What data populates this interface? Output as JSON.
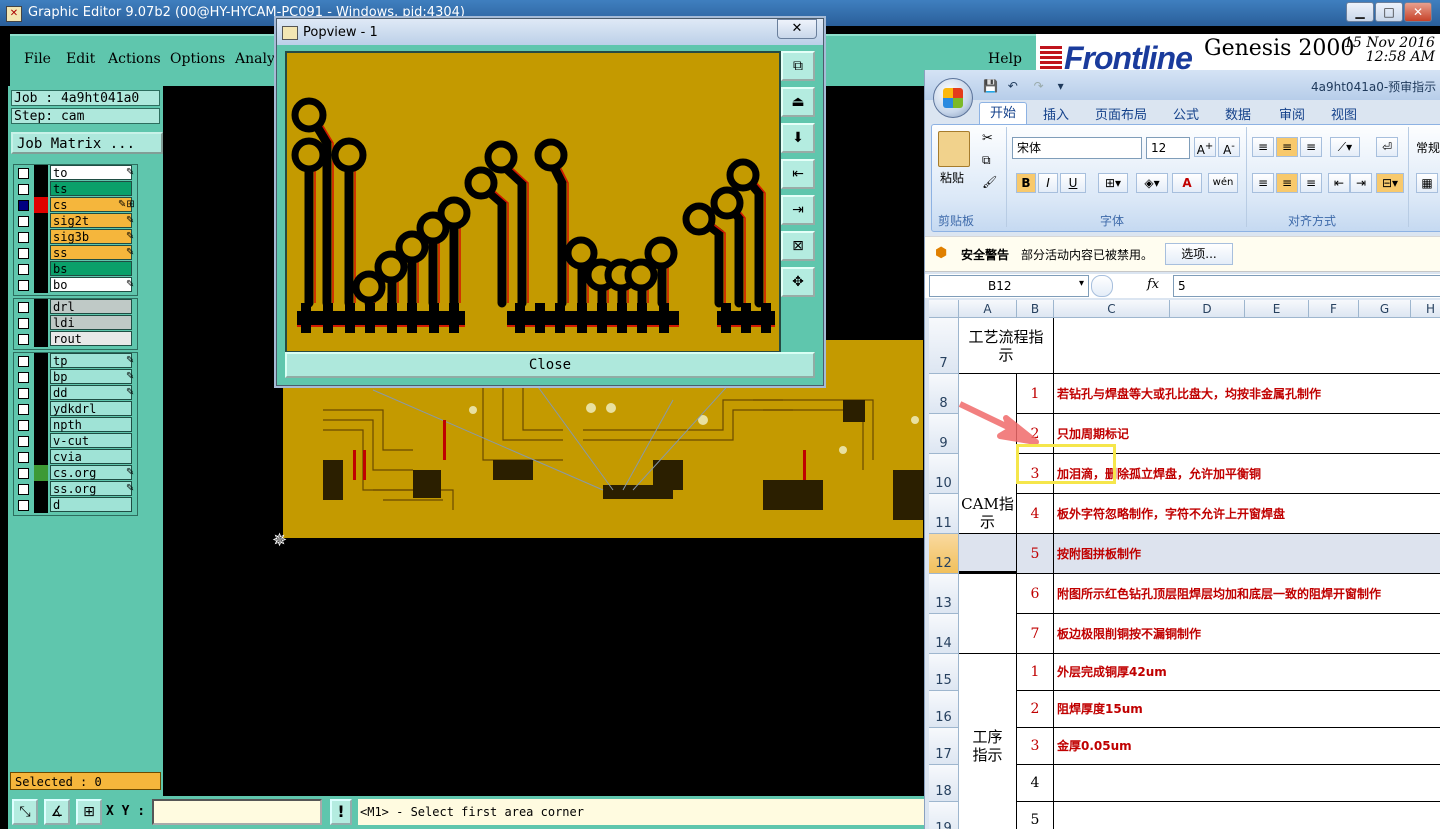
{
  "ge": {
    "title": "Graphic Editor 9.07b2 (00@HY-HYCAM-PC091 - Windows, pid:4304)",
    "menus": [
      "File",
      "Edit",
      "Actions",
      "Options",
      "Analys"
    ],
    "help": "Help",
    "brand": "Frontline",
    "product": "Genesis 2000",
    "date": "15 Nov 2016",
    "time": "12:58 AM",
    "job": "Job : 4a9ht041a0",
    "step": "Step: cam",
    "job_matrix": "Job Matrix ...",
    "layers_signal": [
      {
        "name": "to",
        "color": "#ffffff"
      },
      {
        "name": "ts",
        "color": "#0aa06a"
      },
      {
        "name": "cs",
        "color": "#f5b63c"
      },
      {
        "name": "sig2t",
        "color": "#f5b63c"
      },
      {
        "name": "sig3b",
        "color": "#f5b63c"
      },
      {
        "name": "ss",
        "color": "#f5b63c"
      },
      {
        "name": "bs",
        "color": "#0aa06a"
      },
      {
        "name": "bo",
        "color": "#ffffff"
      }
    ],
    "layers_drill": [
      "drl",
      "ldi",
      "rout"
    ],
    "layers_misc": [
      "tp",
      "bp",
      "dd",
      "ydkdrl",
      "npth",
      "v-cut",
      "cvia",
      "cs.org",
      "ss.org",
      "d"
    ],
    "selected": "Selected : 0",
    "xy_label": "X Y :",
    "prompt": "<M1> - Select first area corner",
    "exclaim": "!"
  },
  "popview": {
    "title": "Popview - 1",
    "close_label": "Close"
  },
  "excel": {
    "doc_title": "4a9ht041a0-预审指示",
    "tabs": [
      "开始",
      "插入",
      "页面布局",
      "公式",
      "数据",
      "审阅",
      "视图"
    ],
    "paste": "粘贴",
    "clipboard": "剪贴板",
    "font_name": "宋体",
    "font_size": "12",
    "font_group": "字体",
    "align_group": "对齐方式",
    "number_format": "常规",
    "bold": "B",
    "italic": "I",
    "underline": "U",
    "font_color_glyph": "A",
    "wen": "wén",
    "security_title": "安全警告",
    "security_msg": "部分活动内容已被禁用。",
    "options_btn": "选项...",
    "namebox": "B12",
    "fx": "fx",
    "formula_value": "5",
    "columns": [
      "A",
      "B",
      "C",
      "D",
      "E",
      "F",
      "G",
      "H"
    ],
    "rows": [
      "7",
      "8",
      "9",
      "10",
      "11",
      "12",
      "13",
      "14",
      "15",
      "16",
      "17",
      "18",
      "19"
    ],
    "row7_label": "工艺流程指示",
    "cam_label": "CAM指示",
    "proc_label": "工序指示",
    "cam_items": [
      {
        "n": "1",
        "t": "若钻孔与焊盘等大或孔比盘大，均按非金属孔制作"
      },
      {
        "n": "2",
        "t": "只加周期标记"
      },
      {
        "n": "3",
        "t": "加泪滴，删除孤立焊盘，允许加平衡铜"
      },
      {
        "n": "4",
        "t": "板外字符忽略制作，字符不允许上开窗焊盘"
      },
      {
        "n": "5",
        "t": "按附图拼板制作"
      },
      {
        "n": "6",
        "t": "附图所示红色钻孔顶层阻焊层均加和底层一致的阻焊开窗制作"
      },
      {
        "n": "7",
        "t": "板边极限削铜按不漏铜制作"
      }
    ],
    "proc_items": [
      {
        "n": "1",
        "t": "外层完成铜厚42um"
      },
      {
        "n": "2",
        "t": "阻焊厚度15um"
      },
      {
        "n": "3",
        "t": "金厚0.05um"
      },
      {
        "n": "4",
        "t": ""
      },
      {
        "n": "5",
        "t": ""
      }
    ]
  }
}
